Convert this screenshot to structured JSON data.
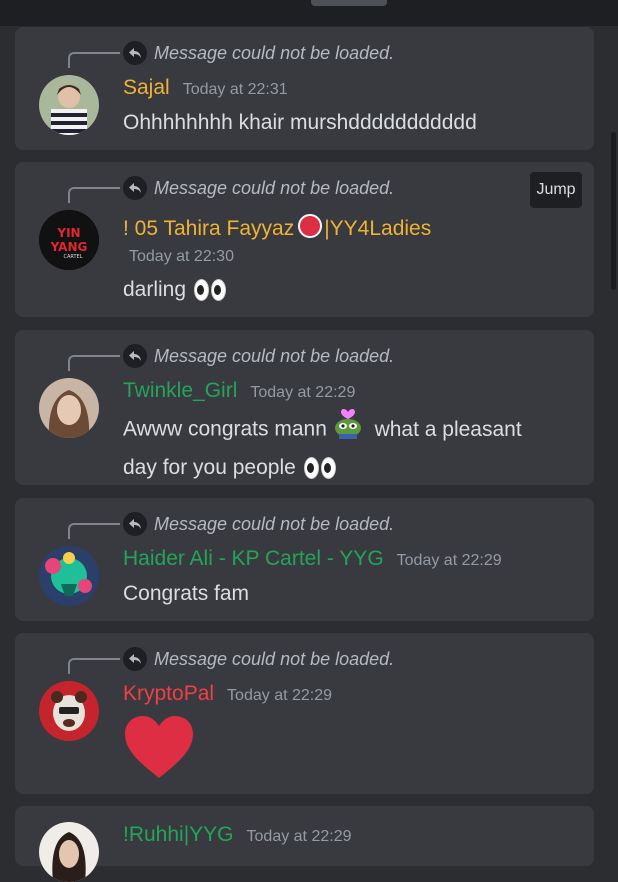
{
  "reply_notice": "Message could not be loaded.",
  "jump_label": "Jump",
  "messages": [
    {
      "username": "Sajal",
      "time": "Today at 22:31",
      "color": "#f0b232",
      "text": "Ohhhhhhhh khair murshddddddddddd"
    },
    {
      "username": "! 05 Tahira Fayyaz",
      "username_suffix": "|YY4Ladies",
      "time": "Today at 22:30",
      "color": "#f0b232",
      "text": "darling",
      "avatar_text": "YIN YANG",
      "avatar_sub": "CARTEL"
    },
    {
      "username": "Twinkle_Girl",
      "time": "Today at 22:29",
      "color": "#23a559",
      "text_line1": "Awww congrats mann",
      "text_line1b": "what a pleasant",
      "text_line2": "day for you people"
    },
    {
      "username": "Haider Ali - KP Cartel - YYG",
      "time": "Today at 22:29",
      "color": "#23a559",
      "text": "Congrats fam"
    },
    {
      "username": "KryptoPal",
      "time": "Today at 22:29",
      "color": "#f23f43"
    },
    {
      "username": "!Ruhhi|YYG",
      "time": "Today at 22:29",
      "color": "#23a559"
    }
  ]
}
